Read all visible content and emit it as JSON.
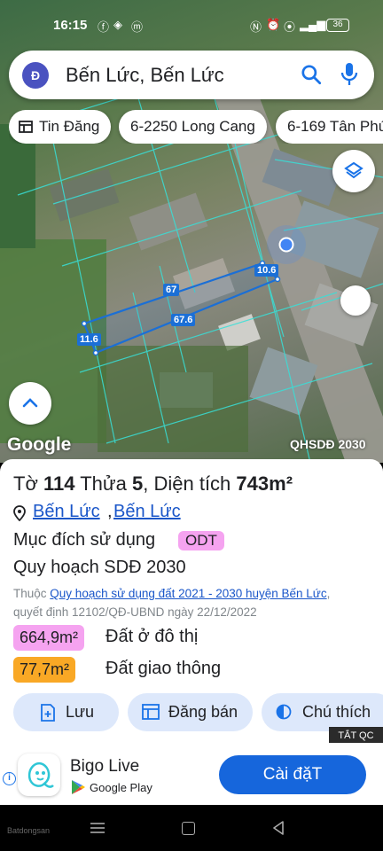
{
  "status_bar": {
    "time": "16:15",
    "battery": "36"
  },
  "search": {
    "avatar_letter": "Đ",
    "query": "Bến Lức, Bến Lức"
  },
  "chips": [
    {
      "label": "Tin Đăng"
    },
    {
      "label": "6-2250 Long Cang"
    },
    {
      "label": "6-169 Tân Phú"
    }
  ],
  "map": {
    "dimensions": [
      "10.6",
      "67",
      "67.6",
      "11.6"
    ],
    "logo": "Google",
    "layer_label": "QHSDĐ 2030"
  },
  "parcel": {
    "to_label": "Tờ",
    "to_value": "114",
    "thua_label": "Thửa",
    "thua_value": "5",
    "area_label": "Diện tích",
    "area_value": "743m²",
    "location_1": "Bến Lức",
    "location_sep": ",",
    "location_2": "Bến Lức",
    "purpose_label": "Mục đích sử dụng",
    "purpose_code": "ODT",
    "plan_label": "Quy hoạch SDĐ 2030",
    "note_prefix": "Thuộc",
    "note_link": "Quy hoạch sử dụng đất 2021 - 2030 huyện Bến Lức",
    "note_suffix": ",",
    "decision": "quyết định 12102/QĐ-UBND ngày 22/12/2022",
    "areas": [
      {
        "value": "664,9m²",
        "label": "Đất ở đô thị",
        "color": "#f5a3f0"
      },
      {
        "value": "77,7m²",
        "label": "Đất giao thông",
        "color": "#f9a825"
      }
    ]
  },
  "actions": [
    {
      "label": "Lưu",
      "icon": "save-icon"
    },
    {
      "label": "Đăng bán",
      "icon": "listing-icon"
    },
    {
      "label": "Chú thích",
      "icon": "legend-icon"
    }
  ],
  "ad": {
    "close_label": "TẮT QC",
    "app_name": "Bigo Live",
    "store": "Google Play",
    "install_label": "Cài đặT"
  },
  "nav": {
    "watermark": "Batdongsan"
  },
  "colors": {
    "accent": "#1666dc",
    "link": "#1a56c9",
    "action_bg": "#dde8fb"
  }
}
